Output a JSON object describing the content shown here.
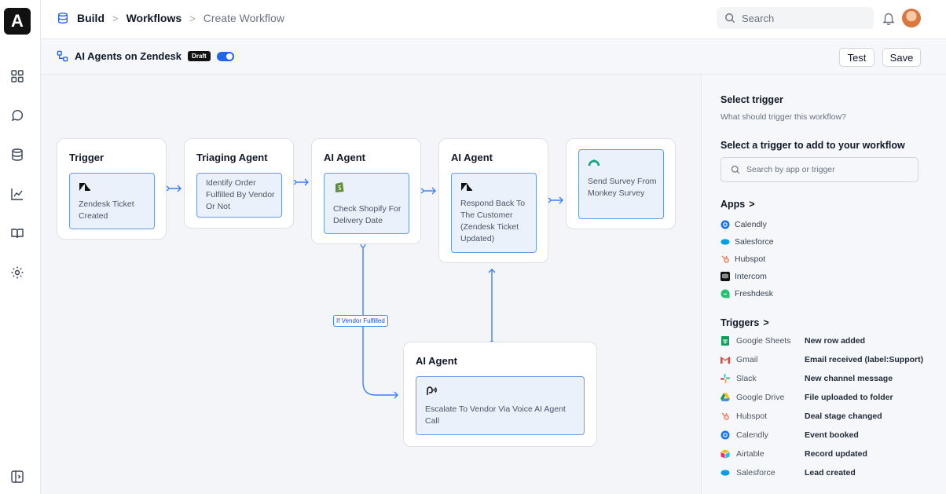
{
  "app": {
    "logo_letter": "A"
  },
  "breadcrumb": [
    "Build",
    "Workflows",
    "Create Workflow"
  ],
  "top_search": {
    "placeholder": "Search"
  },
  "workflow": {
    "title": "AI Agents on Zendesk",
    "status_badge": "Draft",
    "test_label": "Test",
    "save_label": "Save"
  },
  "nodes": {
    "trigger": {
      "title": "Trigger",
      "text": "Zendesk Ticket Created"
    },
    "triage": {
      "title": "Triaging Agent",
      "text": "Identify Order Fulfilled By Vendor  Or Not"
    },
    "shopify": {
      "title": "AI Agent",
      "text": "Check Shopify For Delivery Date"
    },
    "respond": {
      "title": "AI Agent",
      "text": "Respond Back To The Customer (Zendesk Ticket Updated)"
    },
    "survey": {
      "title": "",
      "text": "Send Survey From Monkey Survey"
    },
    "escalate": {
      "title": "AI Agent",
      "text": "Escalate To Vendor Via Voice AI Agent Call"
    },
    "condition": "If Vendor Fulfilled"
  },
  "panel": {
    "title": "Select trigger",
    "subtitle": "What should trigger this workflow?",
    "add_heading": "Select a trigger to add to your workflow",
    "search_placeholder": "Search by app or trigger",
    "apps_heading": "Apps",
    "apps": [
      "Calendly",
      "Salesforce",
      "Hubspot",
      "Intercom",
      "Freshdesk"
    ],
    "triggers_heading": "Triggers",
    "triggers": [
      {
        "app": "Google Sheets",
        "event": "New row added"
      },
      {
        "app": "Gmail",
        "event": "Email received (label:Support)"
      },
      {
        "app": "Slack",
        "event": "New channel message"
      },
      {
        "app": "Google Drive",
        "event": "File uploaded to folder"
      },
      {
        "app": "Hubspot",
        "event": "Deal stage changed"
      },
      {
        "app": "Calendly",
        "event": "Event booked"
      },
      {
        "app": "Airtable",
        "event": "Record updated"
      },
      {
        "app": "Salesforce",
        "event": "Lead created"
      }
    ]
  },
  "colors": {
    "accent": "#2563eb",
    "node_inner_bg": "#eaf1fb",
    "node_inner_border": "#6b9be0"
  }
}
